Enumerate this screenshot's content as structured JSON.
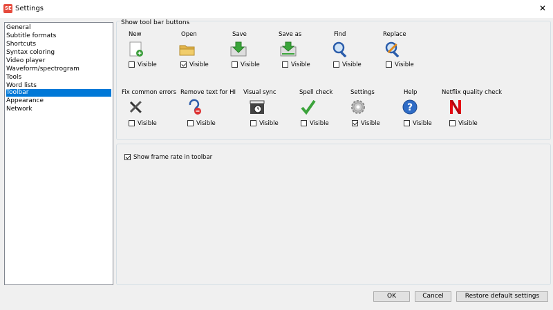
{
  "window": {
    "title": "Settings",
    "close": "✕",
    "app_icon_text": "SE"
  },
  "sidebar": {
    "items": [
      {
        "label": "General",
        "selected": false
      },
      {
        "label": "Subtitle formats",
        "selected": false
      },
      {
        "label": "Shortcuts",
        "selected": false
      },
      {
        "label": "Syntax coloring",
        "selected": false
      },
      {
        "label": "Video player",
        "selected": false
      },
      {
        "label": "Waveform/spectrogram",
        "selected": false
      },
      {
        "label": "Tools",
        "selected": false
      },
      {
        "label": "Word lists",
        "selected": false
      },
      {
        "label": "Toolbar",
        "selected": true
      },
      {
        "label": "Appearance",
        "selected": false
      },
      {
        "label": "Network",
        "selected": false
      }
    ]
  },
  "toolbar_group": {
    "legend": "Show tool bar buttons",
    "visible_label": "Visible",
    "buttons": [
      {
        "label": "New",
        "icon": "new-file-icon",
        "visible": false
      },
      {
        "label": "Open",
        "icon": "open-folder-icon",
        "visible": true
      },
      {
        "label": "Save",
        "icon": "save-icon",
        "visible": false
      },
      {
        "label": "Save as",
        "icon": "save-as-icon",
        "visible": false
      },
      {
        "label": "Find",
        "icon": "find-icon",
        "visible": false
      },
      {
        "label": "Replace",
        "icon": "replace-icon",
        "visible": false
      },
      {
        "label": "Fix common errors",
        "icon": "fix-errors-icon",
        "visible": false
      },
      {
        "label": "Remove text for HI",
        "icon": "remove-hi-icon",
        "visible": false
      },
      {
        "label": "Visual sync",
        "icon": "visual-sync-icon",
        "visible": false
      },
      {
        "label": "Spell check",
        "icon": "spell-check-icon",
        "visible": false
      },
      {
        "label": "Settings",
        "icon": "settings-gear-icon",
        "visible": true
      },
      {
        "label": "Help",
        "icon": "help-icon",
        "visible": false
      },
      {
        "label": "Netflix quality check",
        "icon": "netflix-icon",
        "visible": false
      }
    ]
  },
  "frame_rate": {
    "label": "Show frame rate in toolbar",
    "checked": true
  },
  "footer": {
    "ok": "OK",
    "cancel": "Cancel",
    "restore": "Restore default settings"
  },
  "colors": {
    "selection": "#0078d7",
    "accent_red": "#e64a3c"
  }
}
